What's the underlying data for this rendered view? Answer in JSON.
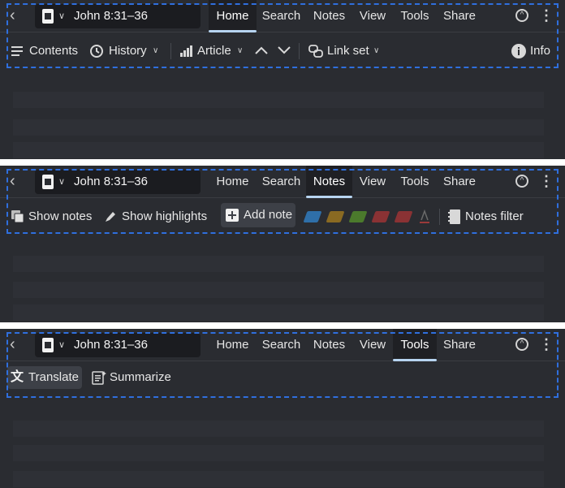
{
  "reference": "John 8:31–36",
  "tabs": [
    "Home",
    "Search",
    "Notes",
    "View",
    "Tools",
    "Share"
  ],
  "home_toolbar": {
    "contents": "Contents",
    "history": "History",
    "article": "Article",
    "link_set": "Link set",
    "info": "Info"
  },
  "notes_toolbar": {
    "show_notes": "Show notes",
    "show_highlights": "Show highlights",
    "add_note": "Add note",
    "notes_filter": "Notes filter",
    "highlight_colors": [
      "#2f6fa8",
      "#8a6a22",
      "#4b7a2c",
      "#8a3234",
      "#8a3234"
    ],
    "text_color": "#9a3a3a"
  },
  "tools_toolbar": {
    "translate": "Translate",
    "summarize": "Summarize"
  },
  "colors": {
    "accent": "#b7d4f0",
    "frame": "#2f6fde"
  }
}
